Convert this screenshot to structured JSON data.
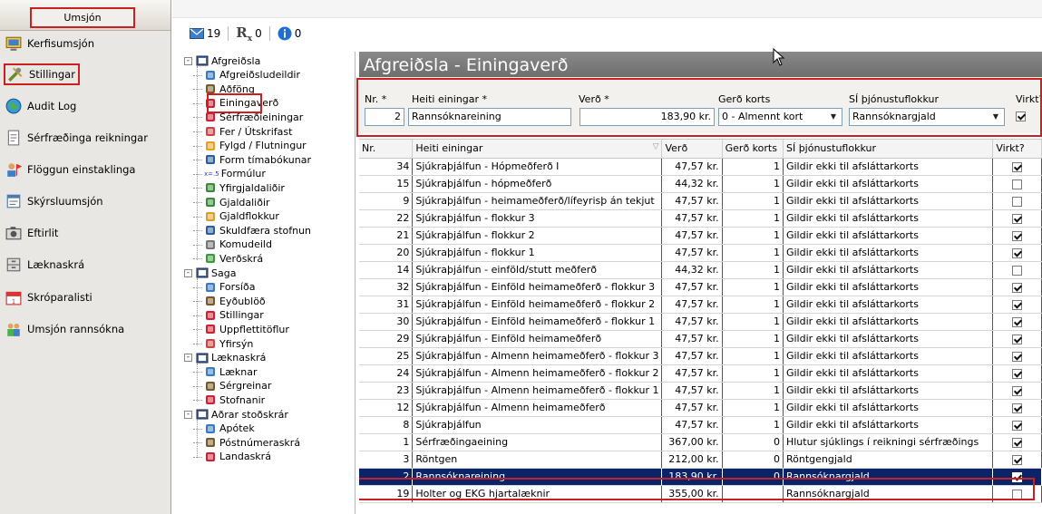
{
  "nav": {
    "title": "Umsjón",
    "items": [
      {
        "label": "Kerfisumsjón",
        "icon": "monitor-icon"
      },
      {
        "label": "Stillingar",
        "icon": "tools-icon"
      },
      {
        "label": "Audit Log",
        "icon": "globe-icon"
      },
      {
        "label": "Sérfræðinga reikningar",
        "icon": "document-icon"
      },
      {
        "label": "Flöggun einstaklinga",
        "icon": "person-flag-icon"
      },
      {
        "label": "Skýrsluumsjón",
        "icon": "report-icon"
      },
      {
        "label": "Eftirlit",
        "icon": "camera-icon"
      },
      {
        "label": "Læknaskrá",
        "icon": "cabinet-icon"
      },
      {
        "label": "Skróparalisti",
        "icon": "calendar-icon"
      },
      {
        "label": "Umsjón rannsókna",
        "icon": "people-icon"
      }
    ]
  },
  "toolbar": {
    "mail_count": "19",
    "rx_label": "R",
    "rx_sub": "x",
    "rx_count": "0",
    "info_count": "0"
  },
  "tree": {
    "groups": [
      {
        "label": "Afgreiðsla",
        "expander": "-",
        "children": [
          "Afgreiðsludeildir",
          "Aðföng",
          "Einingaverð",
          "Sérfræðieiningar",
          "Fer / Útskrifast",
          "Fylgd / Flutningur",
          "Form tímabókunar",
          "Formúlur",
          "Yfirgjaldaliðir",
          "Gjaldaliðir",
          "Gjaldflokkur",
          "Skuldfæra stofnun",
          "Komudeild",
          "Verðskrá"
        ]
      },
      {
        "label": "Saga",
        "expander": "-",
        "children": [
          "Forsíða",
          "Eyðublöð",
          "Stillingar",
          "Uppflettitöflur",
          "Yfirsýn"
        ]
      },
      {
        "label": "Læknaskrá",
        "expander": "-",
        "children": [
          "Læknar",
          "Sérgreinar",
          "Stofnanir"
        ]
      },
      {
        "label": "Aðrar stoðskrár",
        "expander": "-",
        "children": [
          "Apótek",
          "Póstnúmeraskrá",
          "Landaskrá"
        ]
      }
    ],
    "formula_prefix": "x=.5"
  },
  "main": {
    "title": "Afgreiðsla - Einingaverð",
    "form": {
      "labels": {
        "nr": "Nr. *",
        "heiti": "Heiti einingar *",
        "verd": "Verð *",
        "gerd": "Gerð korts",
        "si": "SÍ þjónustuflokkur",
        "virkt": "Virkt?"
      },
      "values": {
        "nr": "2",
        "heiti": "Rannsóknareining",
        "verd": "183,90 kr.",
        "gerd": "0 - Almennt kort",
        "si": "Rannsóknargjald",
        "virkt": true
      }
    },
    "grid": {
      "columns": [
        "Nr.",
        "Heiti einingar",
        "Verð",
        "Gerð korts",
        "SÍ þjónustuflokkur",
        "Virkt?"
      ],
      "sort_indicator": "▽",
      "rows": [
        {
          "nr": "34",
          "heiti": "Sjúkraþjálfun - Hópmeðferð I",
          "verd": "47,57 kr.",
          "gerd": "1",
          "si": "Gildir ekki til afsláttarkorts",
          "virkt": true
        },
        {
          "nr": "15",
          "heiti": "Sjúkraþjálfun - hópmeðferð",
          "verd": "44,32 kr.",
          "gerd": "1",
          "si": "Gildir ekki til afsláttarkorts",
          "virkt": false
        },
        {
          "nr": "9",
          "heiti": "Sjúkraþjálfun - heimameðferð/lífeyrisþ án tekjut",
          "verd": "47,57 kr.",
          "gerd": "1",
          "si": "Gildir ekki til afsláttarkorts",
          "virkt": false
        },
        {
          "nr": "22",
          "heiti": "Sjúkraþjálfun - flokkur 3",
          "verd": "47,57 kr.",
          "gerd": "1",
          "si": "Gildir ekki til afsláttarkorts",
          "virkt": true
        },
        {
          "nr": "21",
          "heiti": "Sjúkraþjálfun - flokkur 2",
          "verd": "47,57 kr.",
          "gerd": "1",
          "si": "Gildir ekki til afsláttarkorts",
          "virkt": true
        },
        {
          "nr": "20",
          "heiti": "Sjúkraþjálfun - flokkur 1",
          "verd": "47,57 kr.",
          "gerd": "1",
          "si": "Gildir ekki til afsláttarkorts",
          "virkt": true
        },
        {
          "nr": "14",
          "heiti": "Sjúkraþjálfun - einföld/stutt meðferð",
          "verd": "44,32 kr.",
          "gerd": "1",
          "si": "Gildir ekki til afsláttarkorts",
          "virkt": false
        },
        {
          "nr": "32",
          "heiti": "Sjúkraþjálfun - Einföld heimameðferð - flokkur 3",
          "verd": "47,57 kr.",
          "gerd": "1",
          "si": "Gildir ekki til afsláttarkorts",
          "virkt": true
        },
        {
          "nr": "31",
          "heiti": "Sjúkraþjálfun - Einföld heimameðferð - flokkur 2",
          "verd": "47,57 kr.",
          "gerd": "1",
          "si": "Gildir ekki til afsláttarkorts",
          "virkt": true
        },
        {
          "nr": "30",
          "heiti": "Sjúkraþjálfun - Einföld heimameðferð - flokkur 1",
          "verd": "47,57 kr.",
          "gerd": "1",
          "si": "Gildir ekki til afsláttarkorts",
          "virkt": true
        },
        {
          "nr": "29",
          "heiti": "Sjúkraþjálfun - Einföld heimameðferð",
          "verd": "47,57 kr.",
          "gerd": "1",
          "si": "Gildir ekki til afsláttarkorts",
          "virkt": true
        },
        {
          "nr": "25",
          "heiti": "Sjúkraþjálfun - Almenn heimameðferð - flokkur 3",
          "verd": "47,57 kr.",
          "gerd": "1",
          "si": "Gildir ekki til afsláttarkorts",
          "virkt": true
        },
        {
          "nr": "24",
          "heiti": "Sjúkraþjálfun - Almenn heimameðferð - flokkur 2",
          "verd": "47,57 kr.",
          "gerd": "1",
          "si": "Gildir ekki til afsláttarkorts",
          "virkt": true
        },
        {
          "nr": "23",
          "heiti": "Sjúkraþjálfun - Almenn heimameðferð - flokkur 1",
          "verd": "47,57 kr.",
          "gerd": "1",
          "si": "Gildir ekki til afsláttarkorts",
          "virkt": true
        },
        {
          "nr": "12",
          "heiti": "Sjúkraþjálfun - Almenn heimameðferð",
          "verd": "47,57 kr.",
          "gerd": "1",
          "si": "Gildir ekki til afsláttarkorts",
          "virkt": true
        },
        {
          "nr": "8",
          "heiti": "Sjúkraþjálfun",
          "verd": "47,57 kr.",
          "gerd": "1",
          "si": "Gildir ekki til afsláttarkorts",
          "virkt": true
        },
        {
          "nr": "1",
          "heiti": "Sérfræðingaeining",
          "verd": "367,00 kr.",
          "gerd": "0",
          "si": "Hlutur sjúklings í reikningi sérfræðings",
          "virkt": true
        },
        {
          "nr": "3",
          "heiti": "Röntgen",
          "verd": "212,00 kr.",
          "gerd": "0",
          "si": "Röntgengjald",
          "virkt": true
        },
        {
          "nr": "2",
          "heiti": "Rannsóknareining",
          "verd": "183,90 kr.",
          "gerd": "0",
          "si": "Rannsóknargjald",
          "virkt": true,
          "selected": true
        },
        {
          "nr": "19",
          "heiti": "Holter og EKG hjartalæknir",
          "verd": "355,00 kr.",
          "gerd": "",
          "si": "Rannsóknargjald",
          "virkt": false
        }
      ]
    }
  },
  "colors": {
    "highlight_red": "#cc2020",
    "selected_row": "#0a246a",
    "header_gray": "#7a7a7a",
    "nav_bg": "#e9e7e3"
  }
}
